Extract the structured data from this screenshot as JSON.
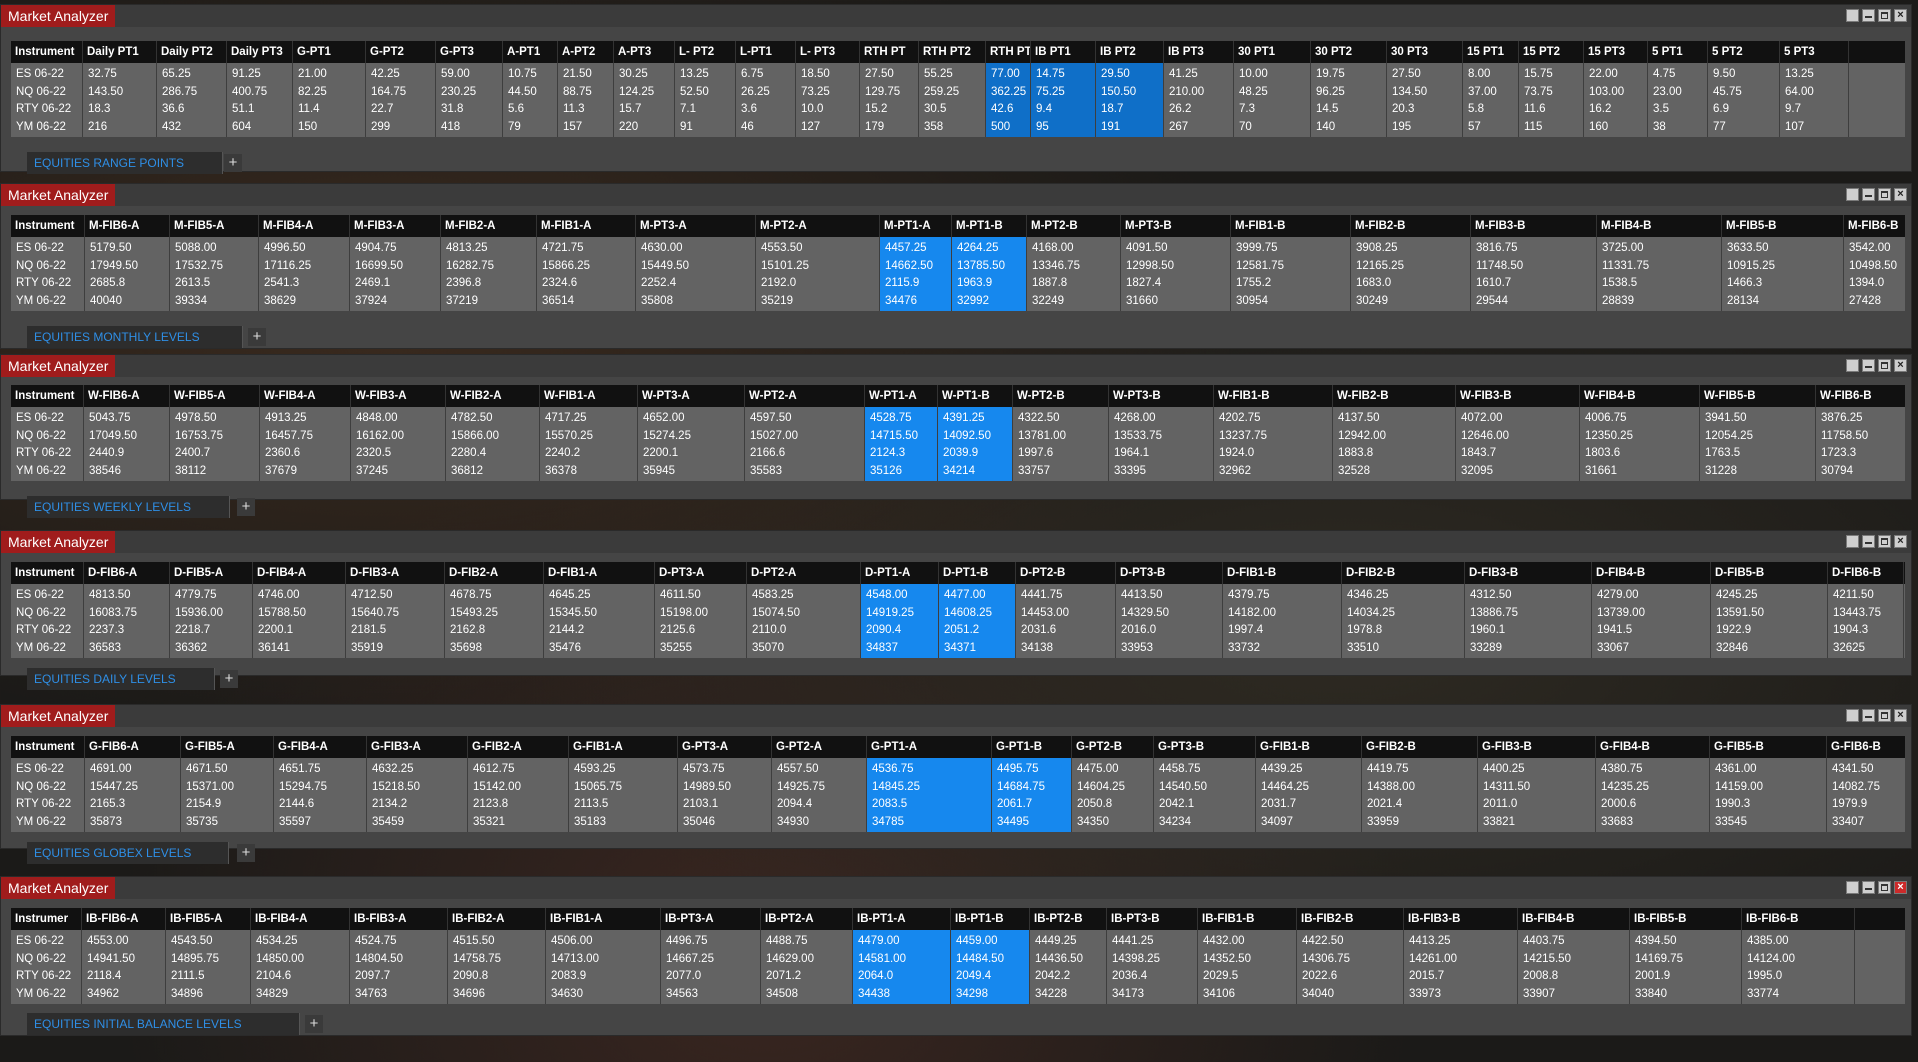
{
  "window_title": "Market Analyzer",
  "windows": [
    {
      "tab": "EQUITIES RANGE POINTS",
      "columns": [
        "Instrument",
        "Daily PT1",
        "Daily PT2",
        "Daily PT3",
        "G-PT1",
        "G-PT2",
        "G-PT3",
        "A-PT1",
        "A-PT2",
        "A-PT3",
        "L- PT2",
        "L-PT1",
        "L- PT3",
        "RTH PT",
        "RTH PT2",
        "RTH PT",
        "IB PT1",
        "IB PT2",
        "IB PT3",
        "30 PT1",
        "30 PT2",
        "30 PT3",
        "15 PT1",
        "15 PT2",
        "15 PT3",
        "5 PT1",
        "5 PT2",
        "5 PT3"
      ],
      "rows": [
        [
          "ES 06-22",
          "32.75",
          "65.25",
          "91.25",
          "21.00",
          "42.25",
          "59.00",
          "10.75",
          "21.50",
          "30.25",
          "13.25",
          "6.75",
          "18.50",
          "27.50",
          "55.25",
          "77.00",
          "14.75",
          "29.50",
          "41.25",
          "10.00",
          "19.75",
          "27.50",
          "8.00",
          "15.75",
          "22.00",
          "4.75",
          "9.50",
          "13.25"
        ],
        [
          "NQ 06-22",
          "143.50",
          "286.75",
          "400.75",
          "82.25",
          "164.75",
          "230.25",
          "44.50",
          "88.75",
          "124.25",
          "52.50",
          "26.25",
          "73.25",
          "129.75",
          "259.25",
          "362.25",
          "75.25",
          "150.50",
          "210.00",
          "48.25",
          "96.25",
          "134.50",
          "37.00",
          "73.75",
          "103.00",
          "23.00",
          "45.75",
          "64.00"
        ],
        [
          "RTY 06-22",
          "18.3",
          "36.6",
          "51.1",
          "11.4",
          "22.7",
          "31.8",
          "5.6",
          "11.3",
          "15.7",
          "7.1",
          "3.6",
          "10.0",
          "15.2",
          "30.5",
          "42.6",
          "9.4",
          "18.7",
          "26.2",
          "7.3",
          "14.5",
          "20.3",
          "5.8",
          "11.6",
          "16.2",
          "3.5",
          "6.9",
          "9.7"
        ],
        [
          "YM 06-22",
          "216",
          "432",
          "604",
          "150",
          "299",
          "418",
          "79",
          "157",
          "220",
          "91",
          "46",
          "127",
          "179",
          "358",
          "500",
          "95",
          "191",
          "267",
          "70",
          "140",
          "195",
          "57",
          "115",
          "160",
          "38",
          "77",
          "107"
        ]
      ]
    },
    {
      "tab": "EQUITIES MONTHLY LEVELS",
      "columns": [
        "Instrument",
        "M-FIB6-A",
        "M-FIB5-A",
        "M-FIB4-A",
        "M-FIB3-A",
        "M-FIB2-A",
        "M-FIB1-A",
        "M-PT3-A",
        "M-PT2-A",
        "M-PT1-A",
        "M-PT1-B",
        "M-PT2-B",
        "M-PT3-B",
        "M-FIB1-B",
        "M-FIB2-B",
        "M-FIB3-B",
        "M-FIB4-B",
        "M-FIB5-B",
        "M-FIB6-B"
      ],
      "rows": [
        [
          "ES 06-22",
          "5179.50",
          "5088.00",
          "4996.50",
          "4904.75",
          "4813.25",
          "4721.75",
          "4630.00",
          "4553.50",
          "4457.25",
          "4264.25",
          "4168.00",
          "4091.50",
          "3999.75",
          "3908.25",
          "3816.75",
          "3725.00",
          "3633.50",
          "3542.00"
        ],
        [
          "NQ 06-22",
          "17949.50",
          "17532.75",
          "17116.25",
          "16699.50",
          "16282.75",
          "15866.25",
          "15449.50",
          "15101.25",
          "14662.50",
          "13785.50",
          "13346.75",
          "12998.50",
          "12581.75",
          "12165.25",
          "11748.50",
          "11331.75",
          "10915.25",
          "10498.50"
        ],
        [
          "RTY 06-22",
          "2685.8",
          "2613.5",
          "2541.3",
          "2469.1",
          "2396.8",
          "2324.6",
          "2252.4",
          "2192.0",
          "2115.9",
          "1963.9",
          "1887.8",
          "1827.4",
          "1755.2",
          "1683.0",
          "1610.7",
          "1538.5",
          "1466.3",
          "1394.0"
        ],
        [
          "YM 06-22",
          "40040",
          "39334",
          "38629",
          "37924",
          "37219",
          "36514",
          "35808",
          "35219",
          "34476",
          "32992",
          "32249",
          "31660",
          "30954",
          "30249",
          "29544",
          "28839",
          "28134",
          "27428"
        ]
      ]
    },
    {
      "tab": "EQUITIES WEEKLY LEVELS",
      "columns": [
        "Instrument",
        "W-FIB6-A",
        "W-FIB5-A",
        "W-FIB4-A",
        "W-FIB3-A",
        "W-FIB2-A",
        "W-FIB1-A",
        "W-PT3-A",
        "W-PT2-A",
        "W-PT1-A",
        "W-PT1-B",
        "W-PT2-B",
        "W-PT3-B",
        "W-FIB1-B",
        "W-FIB2-B",
        "W-FIB3-B",
        "W-FIB4-B",
        "W-FIB5-B",
        "W-FIB6-B"
      ],
      "rows": [
        [
          "ES 06-22",
          "5043.75",
          "4978.50",
          "4913.25",
          "4848.00",
          "4782.50",
          "4717.25",
          "4652.00",
          "4597.50",
          "4528.75",
          "4391.25",
          "4322.50",
          "4268.00",
          "4202.75",
          "4137.50",
          "4072.00",
          "4006.75",
          "3941.50",
          "3876.25"
        ],
        [
          "NQ 06-22",
          "17049.50",
          "16753.75",
          "16457.75",
          "16162.00",
          "15866.00",
          "15570.25",
          "15274.25",
          "15027.00",
          "14715.50",
          "14092.50",
          "13781.00",
          "13533.75",
          "13237.75",
          "12942.00",
          "12646.00",
          "12350.25",
          "12054.25",
          "11758.50"
        ],
        [
          "RTY 06-22",
          "2440.9",
          "2400.7",
          "2360.6",
          "2320.5",
          "2280.4",
          "2240.2",
          "2200.1",
          "2166.6",
          "2124.3",
          "2039.9",
          "1997.6",
          "1964.1",
          "1924.0",
          "1883.8",
          "1843.7",
          "1803.6",
          "1763.5",
          "1723.3"
        ],
        [
          "YM 06-22",
          "38546",
          "38112",
          "37679",
          "37245",
          "36812",
          "36378",
          "35945",
          "35583",
          "35126",
          "34214",
          "33757",
          "33395",
          "32962",
          "32528",
          "32095",
          "31661",
          "31228",
          "30794"
        ]
      ]
    },
    {
      "tab": "EQUITIES DAILY LEVELS",
      "columns": [
        "Instrument",
        "D-FIB6-A",
        "D-FIB5-A",
        "D-FIB4-A",
        "D-FIB3-A",
        "D-FIB2-A",
        "D-FIB1-A",
        "D-PT3-A",
        "D-PT2-A",
        "D-PT1-A",
        "D-PT1-B",
        "D-PT2-B",
        "D-PT3-B",
        "D-FIB1-B",
        "D-FIB2-B",
        "D-FIB3-B",
        "D-FIB4-B",
        "D-FIB5-B",
        "D-FIB6-B"
      ],
      "rows": [
        [
          "ES 06-22",
          "4813.50",
          "4779.75",
          "4746.00",
          "4712.50",
          "4678.75",
          "4645.25",
          "4611.50",
          "4583.25",
          "4548.00",
          "4477.00",
          "4441.75",
          "4413.50",
          "4379.75",
          "4346.25",
          "4312.50",
          "4279.00",
          "4245.25",
          "4211.50"
        ],
        [
          "NQ 06-22",
          "16083.75",
          "15936.00",
          "15788.50",
          "15640.75",
          "15493.25",
          "15345.50",
          "15198.00",
          "15074.50",
          "14919.25",
          "14608.25",
          "14453.00",
          "14329.50",
          "14182.00",
          "14034.25",
          "13886.75",
          "13739.00",
          "13591.50",
          "13443.75"
        ],
        [
          "RTY 06-22",
          "2237.3",
          "2218.7",
          "2200.1",
          "2181.5",
          "2162.8",
          "2144.2",
          "2125.6",
          "2110.0",
          "2090.4",
          "2051.2",
          "2031.6",
          "2016.0",
          "1997.4",
          "1978.8",
          "1960.1",
          "1941.5",
          "1922.9",
          "1904.3"
        ],
        [
          "YM 06-22",
          "36583",
          "36362",
          "36141",
          "35919",
          "35698",
          "35476",
          "35255",
          "35070",
          "34837",
          "34371",
          "34138",
          "33953",
          "33732",
          "33510",
          "33289",
          "33067",
          "32846",
          "32625"
        ]
      ]
    },
    {
      "tab": "EQUITIES GLOBEX LEVELS",
      "columns": [
        "Instrument",
        "G-FIB6-A",
        "G-FIB5-A",
        "G-FIB4-A",
        "G-FIB3-A",
        "G-FIB2-A",
        "G-FIB1-A",
        "G-PT3-A",
        "G-PT2-A",
        "G-PT1-A",
        "G-PT1-B",
        "G-PT2-B",
        "G-PT3-B",
        "G-FIB1-B",
        "G-FIB2-B",
        "G-FIB3-B",
        "G-FIB4-B",
        "G-FIB5-B",
        "G-FIB6-B"
      ],
      "rows": [
        [
          "ES 06-22",
          "4691.00",
          "4671.50",
          "4651.75",
          "4632.25",
          "4612.75",
          "4593.25",
          "4573.75",
          "4557.50",
          "4536.75",
          "4495.75",
          "4475.00",
          "4458.75",
          "4439.25",
          "4419.75",
          "4400.25",
          "4380.75",
          "4361.00",
          "4341.50"
        ],
        [
          "NQ 06-22",
          "15447.25",
          "15371.00",
          "15294.75",
          "15218.50",
          "15142.00",
          "15065.75",
          "14989.50",
          "14925.75",
          "14845.25",
          "14684.75",
          "14604.25",
          "14540.50",
          "14464.25",
          "14388.00",
          "14311.50",
          "14235.25",
          "14159.00",
          "14082.75"
        ],
        [
          "RTY 06-22",
          "2165.3",
          "2154.9",
          "2144.6",
          "2134.2",
          "2123.8",
          "2113.5",
          "2103.1",
          "2094.4",
          "2083.5",
          "2061.7",
          "2050.8",
          "2042.1",
          "2031.7",
          "2021.4",
          "2011.0",
          "2000.6",
          "1990.3",
          "1979.9"
        ],
        [
          "YM 06-22",
          "35873",
          "35735",
          "35597",
          "35459",
          "35321",
          "35183",
          "35046",
          "34930",
          "34785",
          "34495",
          "34350",
          "34234",
          "34097",
          "33959",
          "33821",
          "33683",
          "33545",
          "33407"
        ]
      ]
    },
    {
      "tab": "EQUITIES INITIAL BALANCE LEVELS",
      "columns": [
        "Instrumer",
        "IB-FIB6-A",
        "IB-FIB5-A",
        "IB-FIB4-A",
        "IB-FIB3-A",
        "IB-FIB2-A",
        "IB-FIB1-A",
        "IB-PT3-A",
        "IB-PT2-A",
        "IB-PT1-A",
        "IB-PT1-B",
        "IB-PT2-B",
        "IB-PT3-B",
        "IB-FIB1-B",
        "IB-FIB2-B",
        "IB-FIB3-B",
        "IB-FIB4-B",
        "IB-FIB5-B",
        "IB-FIB6-B"
      ],
      "rows": [
        [
          "ES 06-22",
          "4553.00",
          "4543.50",
          "4534.25",
          "4524.75",
          "4515.50",
          "4506.00",
          "4496.75",
          "4488.75",
          "4479.00",
          "4459.00",
          "4449.25",
          "4441.25",
          "4432.00",
          "4422.50",
          "4413.25",
          "4403.75",
          "4394.50",
          "4385.00"
        ],
        [
          "NQ 06-22",
          "14941.50",
          "14895.75",
          "14850.00",
          "14804.50",
          "14758.75",
          "14713.00",
          "14667.25",
          "14629.00",
          "14581.00",
          "14484.50",
          "14436.50",
          "14398.25",
          "14352.50",
          "14306.75",
          "14261.00",
          "14215.50",
          "14169.75",
          "14124.00"
        ],
        [
          "RTY 06-22",
          "2118.4",
          "2111.5",
          "2104.6",
          "2097.7",
          "2090.8",
          "2083.9",
          "2077.0",
          "2071.2",
          "2064.0",
          "2049.4",
          "2042.2",
          "2036.4",
          "2029.5",
          "2022.6",
          "2015.7",
          "2008.8",
          "2001.9",
          "1995.0"
        ],
        [
          "YM 06-22",
          "34962",
          "34896",
          "34829",
          "34763",
          "34696",
          "34630",
          "34563",
          "34508",
          "34438",
          "34298",
          "34228",
          "34173",
          "34106",
          "34040",
          "33973",
          "33907",
          "33840",
          "33774"
        ]
      ]
    }
  ]
}
